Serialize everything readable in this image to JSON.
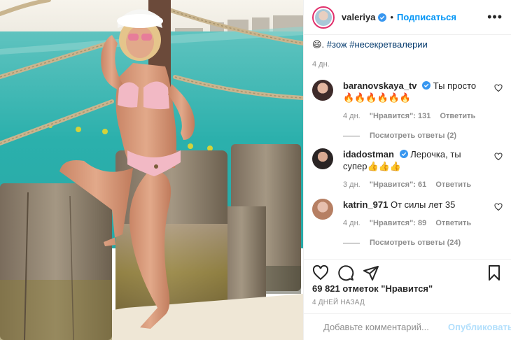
{
  "post": {
    "author": {
      "username": "valeriya",
      "follow_label": "Подписаться",
      "separator": "•"
    },
    "caption": {
      "text_prefix": "😄. ",
      "hashtags": "#зож #несекретвалерии",
      "time": "4 дн."
    },
    "comments": [
      {
        "username": "baranovskaya_tv",
        "verified": true,
        "text": "Ты просто 🔥🔥🔥🔥🔥🔥",
        "time": "4 дн.",
        "likes": "\"Нравится\": 131",
        "reply_label": "Ответить",
        "view_replies": "Посмотреть ответы (2)"
      },
      {
        "username": "idadostman",
        "verified": true,
        "text": "Лерочка, ты супер👍👍👍",
        "time": "3 дн.",
        "likes": "\"Нравится\": 61",
        "reply_label": "Ответить",
        "view_replies": ""
      },
      {
        "username": "katrin_971",
        "verified": false,
        "text": "От силы лет 35",
        "time": "4 дн.",
        "likes": "\"Нравится\": 89",
        "reply_label": "Ответить",
        "view_replies": "Посмотреть ответы (24)"
      }
    ],
    "likes_total": "69 821 отметок \"Нравится\"",
    "date": "4 ДНЕЙ НАЗАД",
    "comment_box": {
      "placeholder": "Добавьте комментарий...",
      "publish_label": "Опубликовать"
    }
  },
  "icons": {
    "more": "more-horizontal-icon",
    "like": "heart-icon",
    "comment": "comment-bubble-icon",
    "share": "paper-plane-icon",
    "save": "bookmark-icon",
    "emoji": "smiley-icon",
    "verified": "verified-badge-icon"
  },
  "colors": {
    "accent": "#0095f6",
    "hashtag": "#00376b",
    "muted": "#8e8e8e",
    "verified": "#3897f0",
    "publish_disabled": "#b2dffc"
  }
}
